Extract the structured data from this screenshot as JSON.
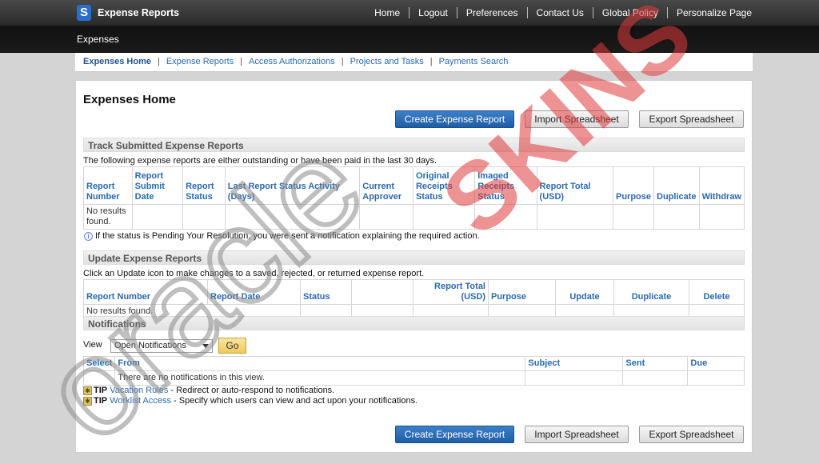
{
  "header": {
    "logo_letter": "S",
    "app_title": "Expense Reports",
    "global_nav": [
      "Home",
      "Logout",
      "Preferences",
      "Contact Us",
      "Global Policy",
      "Personalize Page"
    ]
  },
  "secondary_bar": {
    "label": "Expenses"
  },
  "subnav": [
    "Expenses Home",
    "Expense Reports",
    "Access Authorizations",
    "Projects and Tasks",
    "Payments Search"
  ],
  "main": {
    "title": "Expenses Home",
    "buttons": {
      "create": "Create Expense Report",
      "import": "Import Spreadsheet",
      "export": "Export Spreadsheet"
    },
    "track": {
      "heading": "Track Submitted Expense Reports",
      "description": "The following expense reports are either outstanding or have been paid in the last 30 days.",
      "columns": [
        "Report Number",
        "Report Submit Date",
        "Report Status",
        "Last Report Status Activity (Days)",
        "Current Approver",
        "Original Receipts Status",
        "Imaged Receipts Status",
        "Report Total (USD)",
        "Purpose",
        "Duplicate",
        "Withdraw"
      ],
      "empty_text": "No results found.",
      "note": "If the status is Pending Your Resolution, you were sent a notification explaining the required action."
    },
    "update": {
      "heading": "Update Expense Reports",
      "description": "Click an Update icon to make changes to a saved, rejected, or returned expense report.",
      "columns": [
        "Report Number",
        "Report Date",
        "Status",
        "",
        "Report Total (USD)",
        "Purpose",
        "Update",
        "Duplicate",
        "Delete"
      ],
      "empty_text": "No results found."
    },
    "notifications": {
      "heading": "Notifications",
      "view_label": "View",
      "view_selected": "Open Notifications",
      "go_label": "Go",
      "columns": [
        "Select",
        "From",
        "Subject",
        "Sent",
        "Due"
      ],
      "empty_text": "There are no notifications in this view.",
      "tips": [
        {
          "prefix": "TIP",
          "link": "Vacation Rules",
          "text": " - Redirect or auto-respond to notifications."
        },
        {
          "prefix": "TIP",
          "link": "Worklist Access",
          "text": " - Specify which users can view and act upon your notifications."
        }
      ]
    }
  },
  "watermark": {
    "text1": "oracle",
    "text2": "SKINS",
    "color1": "#999999",
    "color2": "#e03a3a"
  },
  "colors": {
    "primary_button": "#2a6ab8",
    "link": "#2a6ab0",
    "topbar": "#3a3a3a"
  }
}
